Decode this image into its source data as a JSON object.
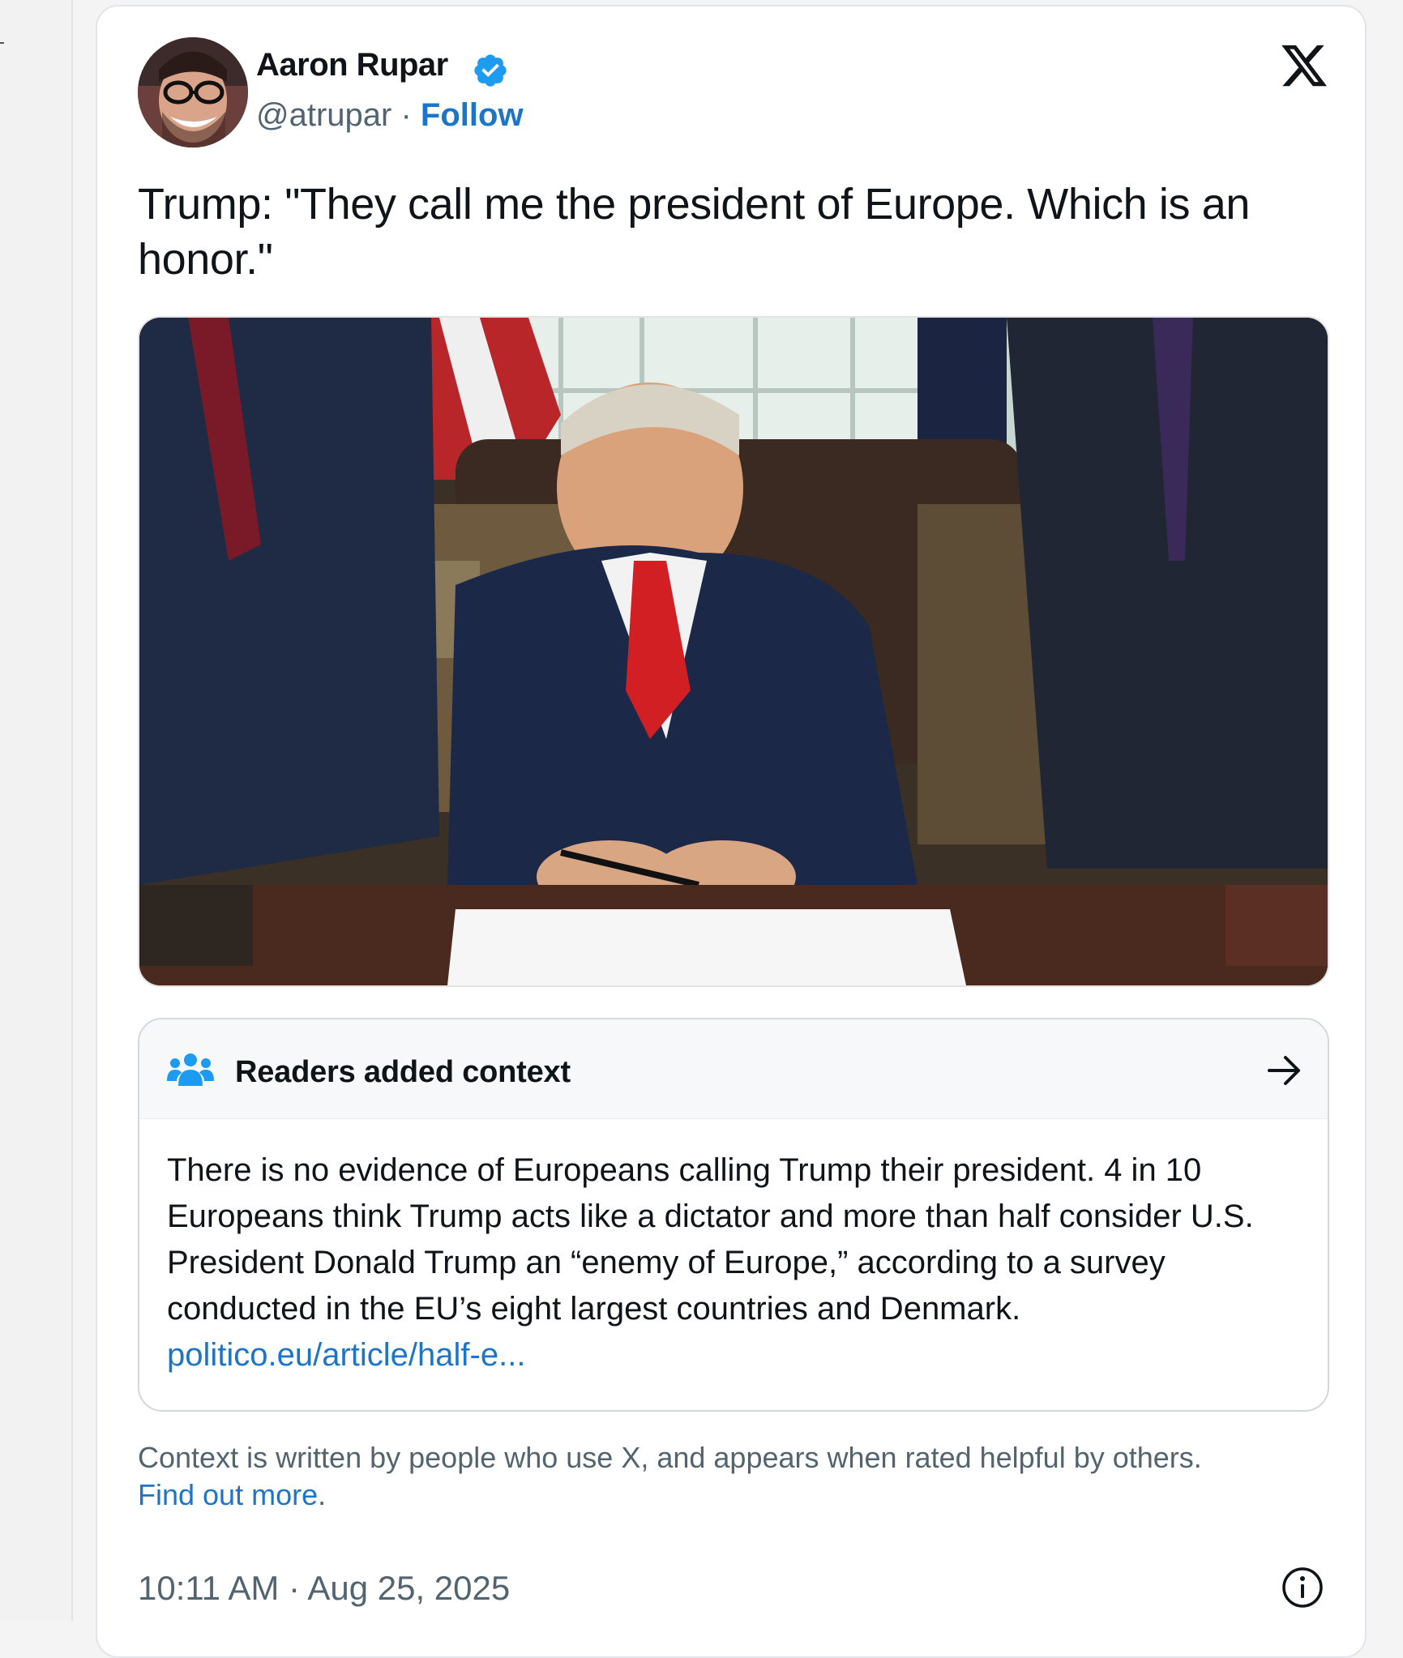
{
  "author": {
    "name": "Aaron Rupar",
    "handle": "@atrupar",
    "separator": "·",
    "follow_label": "Follow"
  },
  "tweet": {
    "text": "Trump: \"They call me the president of Europe. Which is an honor.\""
  },
  "context": {
    "title": "Readers added context",
    "body": "There is no evidence of Europeans calling Trump their president. 4 in 10 Europeans think Trump acts like a dictator and more than half consider U.S. President Donald Trump an “enemy of Europe,” according to a survey conducted in the EU’s eight largest countries and Denmark.",
    "link": "politico.eu/article/half-e..."
  },
  "footnote": {
    "text": "Context is written by people who use X, and appears when rated helpful by others.",
    "link_label": "Find out more",
    "suffix": "."
  },
  "meta": {
    "timestamp": "10:11 AM · Aug 25, 2025"
  },
  "colors": {
    "accent": "#1d75c9",
    "verified": "#1d9bf0",
    "muted_text": "#536471"
  }
}
